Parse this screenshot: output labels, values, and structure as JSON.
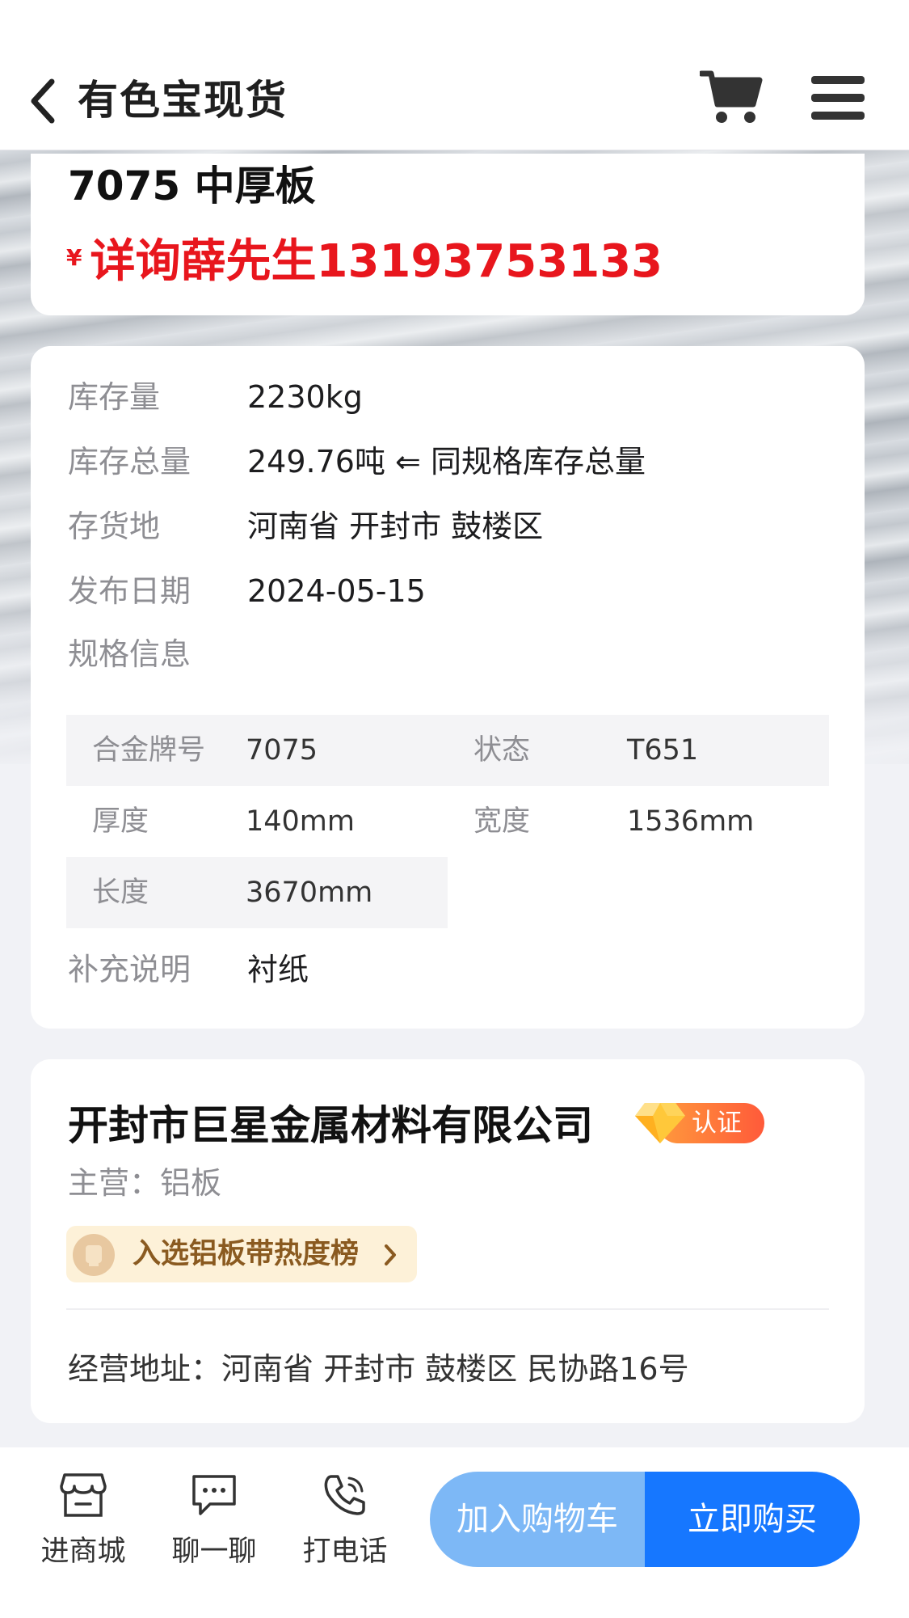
{
  "header": {
    "title": "有色宝现货",
    "back_icon": "chevron-left-icon",
    "cart_icon": "shopping-cart-icon",
    "menu_icon": "hamburger-menu-icon"
  },
  "product": {
    "name": "7075 中厚板",
    "price_symbol": "¥",
    "price_text": "详询薛先生13193753133",
    "price_color": "#e8161d"
  },
  "details": {
    "rows": [
      {
        "label": "库存量",
        "value": "2230kg"
      },
      {
        "label": "库存总量",
        "value": "249.76吨 ⇐ 同规格库存总量"
      },
      {
        "label": "存货地",
        "value": "河南省 开封市 鼓楼区"
      },
      {
        "label": "发布日期",
        "value": "2024-05-15"
      },
      {
        "label": "规格信息",
        "value": ""
      }
    ],
    "spec": [
      {
        "label": "合金牌号",
        "value": "7075"
      },
      {
        "label": "状态",
        "value": "T651"
      },
      {
        "label": "厚度",
        "value": "140mm"
      },
      {
        "label": "宽度",
        "value": "1536mm"
      },
      {
        "label": "长度",
        "value": "3670mm"
      }
    ],
    "supplement_label": "补充说明",
    "supplement_value": "衬纸"
  },
  "company": {
    "name": "开封市巨星金属材料有限公司",
    "cert_label": "认证",
    "cert_icon": "diamond-icon",
    "main_business": "主营：铝板",
    "hot_rank": "入选铝板带热度榜",
    "address": "经营地址：河南省 开封市 鼓楼区 民协路16号"
  },
  "bottom_bar": {
    "shop": {
      "label": "进商城",
      "icon": "storefront-icon"
    },
    "chat": {
      "label": "聊一聊",
      "icon": "chat-bubble-icon"
    },
    "call": {
      "label": "打电话",
      "icon": "phone-icon"
    },
    "add_to_cart": "加入购物车",
    "buy_now": "立即购买",
    "accent": "#1677ff",
    "accent_light": "#7db8f6"
  }
}
